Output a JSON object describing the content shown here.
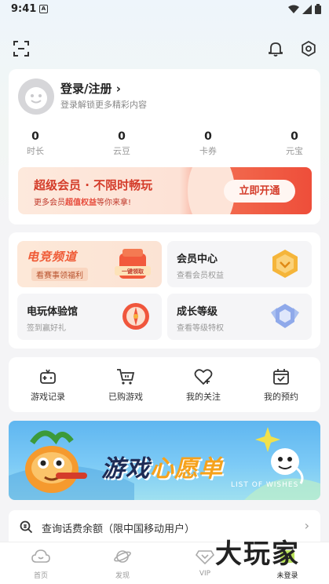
{
  "status_bar": {
    "time": "9:41",
    "notif_glyph": "A"
  },
  "top": {
    "scan_icon": "scan-icon",
    "bell_icon": "bell-icon",
    "settings_icon": "settings-icon"
  },
  "profile": {
    "title": "登录/注册 ›",
    "subtitle": "登录解锁更多精彩内容",
    "stats": [
      {
        "value": "0",
        "label": "时长"
      },
      {
        "value": "0",
        "label": "云豆"
      },
      {
        "value": "0",
        "label": "卡券"
      },
      {
        "value": "0",
        "label": "元宝"
      }
    ],
    "vip": {
      "title": "超级会员 · 不限时畅玩",
      "sub_prefix": "更多会员",
      "sub_highlight": "超值权益",
      "sub_suffix": "等你来拿!",
      "button": "立即开通",
      "badge": "一键领取"
    }
  },
  "tiles": [
    {
      "title": "电竞频道",
      "sub": "看赛事领福利"
    },
    {
      "title": "会员中心",
      "sub": "查看会员权益"
    },
    {
      "title": "电玩体验馆",
      "sub": "签到赢好礼"
    },
    {
      "title": "成长等级",
      "sub": "查看等级特权"
    }
  ],
  "actions": [
    {
      "label": "游戏记录",
      "icon": "gamepad-icon"
    },
    {
      "label": "已购游戏",
      "icon": "cart-icon"
    },
    {
      "label": "我的关注",
      "icon": "heart-icon"
    },
    {
      "label": "我的预约",
      "icon": "calendar-icon"
    }
  ],
  "wish_banner": {
    "title_a": "游戏",
    "title_b": "心愿单",
    "subtitle": "LIST OF WISHES"
  },
  "recharge": {
    "label": "查询话费余额（限中国移动用户）",
    "arrow": "›"
  },
  "tabs": [
    {
      "label": "首页",
      "icon": "cloud-home-icon"
    },
    {
      "label": "发现",
      "icon": "planet-icon"
    },
    {
      "label": "VIP",
      "icon": "vip-diamond-icon"
    },
    {
      "label": "未登录",
      "icon": "profile-icon"
    }
  ],
  "watermark": "大玩家",
  "colors": {
    "accent_red": "#d43c2a",
    "esports_orange": "#ef5a35",
    "wish_blue": "#5fb6f0"
  }
}
